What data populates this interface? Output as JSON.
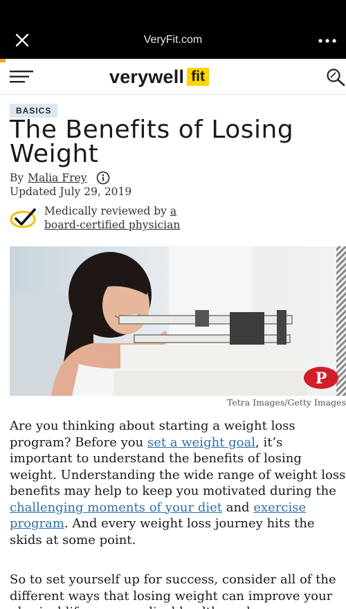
{
  "browser": {
    "site": "VeryFit.com",
    "close_icon": "close-icon",
    "more_icon": "more-dots-icon"
  },
  "header": {
    "logo_word": "verywell",
    "logo_badge": "fit",
    "brand_color": "#ffd400"
  },
  "article": {
    "tag": "BASICS",
    "title": "The Benefits of Losing Weight",
    "by_label": "By",
    "author": "Malia Frey",
    "updated": "Updated July 29, 2019",
    "review_text": "Medically reviewed by",
    "review_link_1": "a",
    "review_link_2": "board-certified physician",
    "image_credit": "Tetra Images/Getty Images",
    "p1": {
      "t1": "Are you thinking about starting a weight loss program? Before you ",
      "l1": "set a weight goal",
      "t2": ", it’s important to understand the benefits of losing weight. Understanding the wide range of weight loss benefits may help to keep you motivated during the ",
      "l2": "challenging moments of your diet",
      "t3": " and ",
      "l3": "exercise program",
      "t4": ". And every weight loss journey hits the skids at some point."
    },
    "p2": "So to set yourself up for success, consider all of the different ways that losing weight can improve your physical life, your medical health, and your emotional well-being.",
    "link_color": "#2f6fa8"
  }
}
